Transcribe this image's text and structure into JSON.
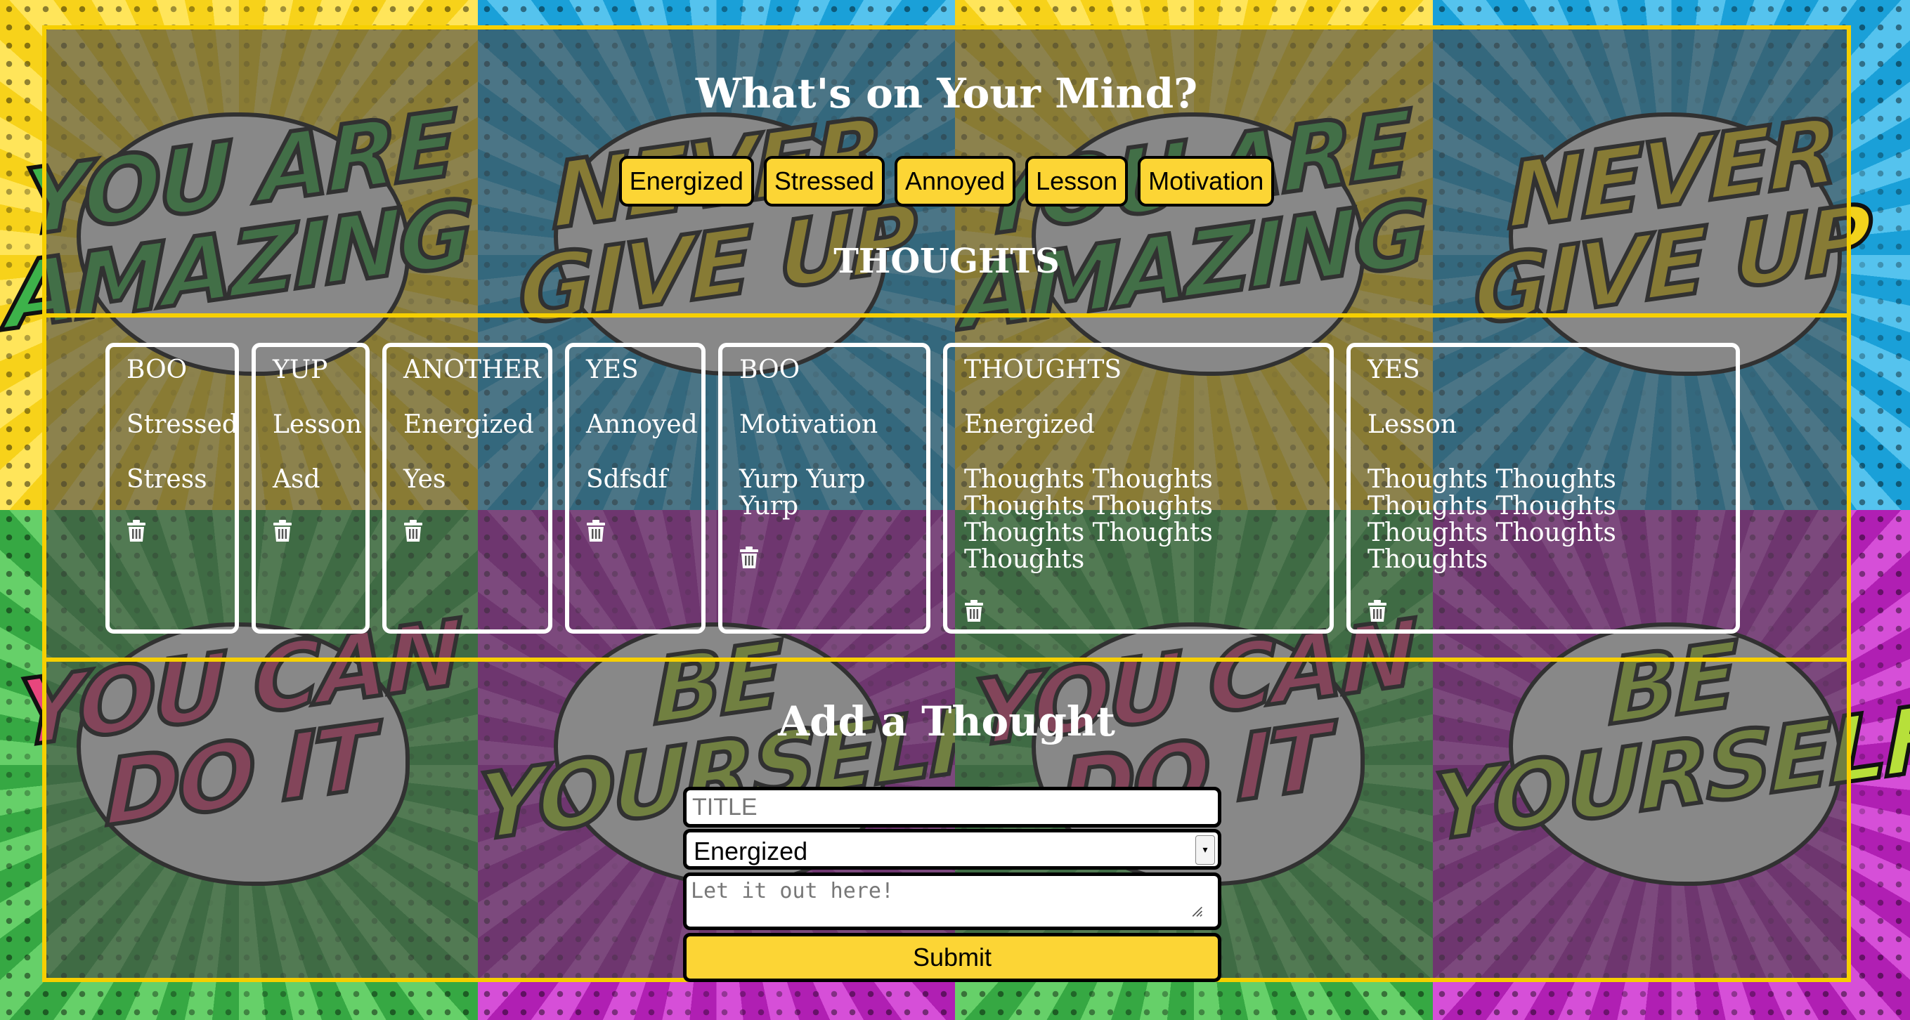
{
  "header": {
    "title": "What's on Your Mind?",
    "moods": [
      "Energized",
      "Stressed",
      "Annoyed",
      "Lesson",
      "Motivation"
    ],
    "thoughts_heading": "THOUGHTS"
  },
  "cards": [
    {
      "title": "BOO",
      "mood": "Stressed",
      "body": "Stress"
    },
    {
      "title": "YUP",
      "mood": "Lesson",
      "body": "Asd"
    },
    {
      "title": "ANOTHER",
      "mood": "Energized",
      "body": "Yes"
    },
    {
      "title": "YES",
      "mood": "Annoyed",
      "body": "Sdfsdf"
    },
    {
      "title": "BOO",
      "mood": "Motivation",
      "body": "Yurp Yurp Yurp"
    },
    {
      "title": "THOUGHTS",
      "mood": "Energized",
      "body": "Thoughts Thoughts Thoughts Thoughts Thoughts Thoughts Thoughts"
    },
    {
      "title": "YES",
      "mood": "Lesson",
      "body": "Thoughts Thoughts Thoughts Thoughts Thoughts Thoughts Thoughts"
    }
  ],
  "form": {
    "heading": "Add a Thought",
    "title_placeholder": "TITLE",
    "mood_selected": "Energized",
    "body_placeholder": "Let it out here!",
    "submit_label": "Submit"
  },
  "background": {
    "slogans": [
      "YOU ARE AMAZING",
      "NEVER GIVE UP",
      "YOU CAN DO IT",
      "BE YOURSELF"
    ]
  },
  "colors": {
    "accent": "#fcd535",
    "panel_border": "#f6cf00",
    "panel_overlay": "rgba(70,70,70,0.62)"
  }
}
